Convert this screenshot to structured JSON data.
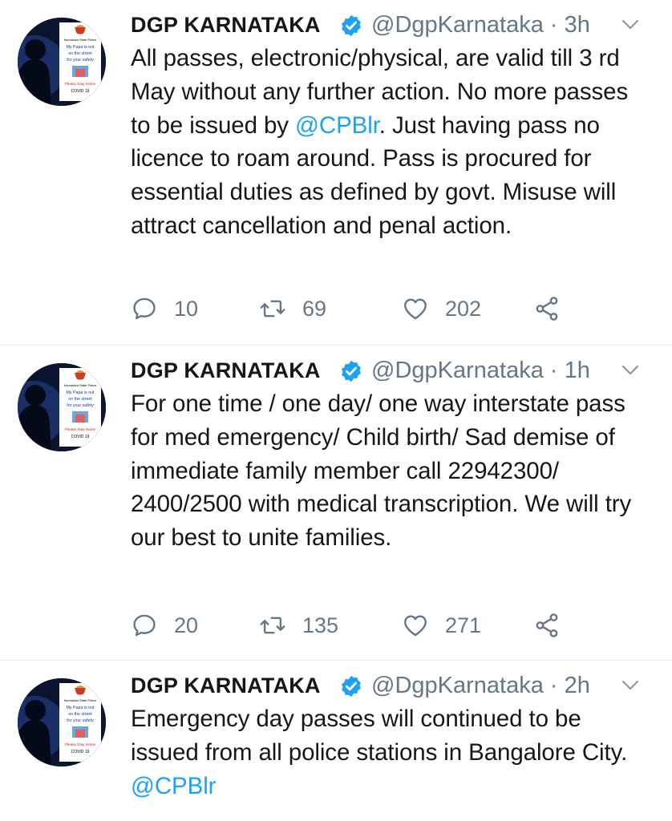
{
  "tweets": [
    {
      "author_name": "DGP KARNATAKA",
      "handle_time": "@DgpKarnataka · 3h",
      "avatar": {
        "org": "Karnataka State Police",
        "line1": "My Papa is out",
        "line2": "on the street",
        "line3": "for your safety",
        "stay": "Please Stay Home",
        "covid": "COVID 19"
      },
      "text_before": "All passes, electronic/physical, are valid till 3 rd May without any further action. No more passes to be issued by ",
      "mention": "@CPBlr",
      "text_after": ". Just having pass no licence to roam around. Pass is procured for essential duties as defined by govt. Misuse will attract cancellation and penal action.",
      "replies": "10",
      "retweets": "69",
      "likes": "202"
    },
    {
      "author_name": "DGP KARNATAKA",
      "handle_time": "@DgpKarnataka · 1h",
      "avatar": {
        "org": "Karnataka State Police",
        "line1": "My Papa is out",
        "line2": "on the street",
        "line3": "for your safety",
        "stay": "Please Stay Home",
        "covid": "COVID 19"
      },
      "text": "For one time / one day/ one way interstate pass for med emergency/ Child birth/ Sad demise of immediate family member call 22942300/ 2400/2500 with medical transcription. We will try our best to unite families.",
      "replies": "20",
      "retweets": "135",
      "likes": "271"
    },
    {
      "author_name": "DGP KARNATAKA",
      "handle_time": "@DgpKarnataka · 2h",
      "avatar": {
        "org": "Karnataka State Police",
        "line1": "My Papa is out",
        "line2": "on the street",
        "line3": "for your safety",
        "stay": "Please Stay Home",
        "covid": "COVID 19"
      },
      "text_before": "Emergency day passes will continued to be issued from all police stations in Bangalore City. ",
      "mention": "@CPBlr"
    }
  ],
  "colors": {
    "verified_badge": "#1da1f2",
    "mention": "#1da1f2",
    "secondary_text": "#657786",
    "divider": "#e6ecf0"
  },
  "icons": [
    "verified-icon",
    "chevron-down-icon",
    "reply-icon",
    "retweet-icon",
    "like-icon",
    "share-icon"
  ]
}
